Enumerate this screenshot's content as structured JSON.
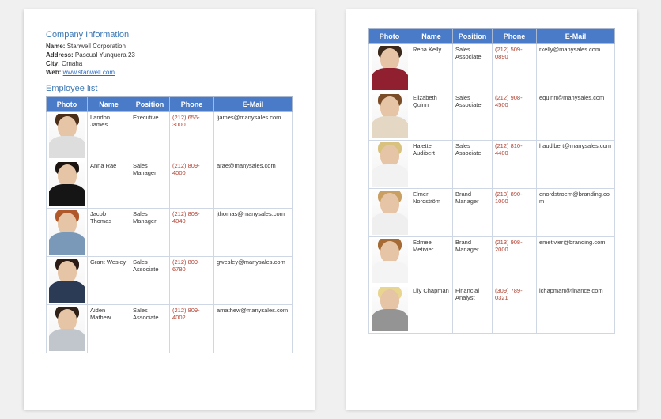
{
  "company": {
    "section_title": "Company Information",
    "name_label": "Name:",
    "name": "Stanwell Corporation",
    "address_label": "Address:",
    "address": "Pascual Yunquera 23",
    "city_label": "City:",
    "city": "Omaha",
    "web_label": "Web:",
    "web": "www.stanwell.com"
  },
  "employee_list_title": "Employee list",
  "table_headers": {
    "photo": "Photo",
    "name": "Name",
    "position": "Position",
    "phone": "Phone",
    "email": "E-Mail"
  },
  "employees_page1": [
    {
      "name": "Landon James",
      "position": "Executive",
      "phone": "(212) 656-3000",
      "email": "ljames@manysales.com",
      "hair": "#4a2e18",
      "shirt": "#dddddd"
    },
    {
      "name": "Anna Rae",
      "position": "Sales Manager",
      "phone": "(212) 809-4000",
      "email": "arae@manysales.com",
      "hair": "#1c1410",
      "shirt": "#151515"
    },
    {
      "name": "Jacob Thomas",
      "position": "Sales Manager",
      "phone": "(212) 808-4040",
      "email": "jthomas@manysales.com",
      "hair": "#b1582a",
      "shirt": "#7a99b8"
    },
    {
      "name": "Grant Wesley",
      "position": "Sales Associate",
      "phone": "(212) 809-6780",
      "email": "gwesley@manysales.com",
      "hair": "#2a1c14",
      "shirt": "#2b3a55"
    },
    {
      "name": "Aiden Mathew",
      "position": "Sales Associate",
      "phone": "(212) 809-4002",
      "email": "amathew@manysales.com",
      "hair": "#2e2016",
      "shirt": "#c0c6cc"
    }
  ],
  "employees_page2": [
    {
      "name": "Rena Kelly",
      "position": "Sales Associate",
      "phone": "(212) 509-0890",
      "email": "rkelly@manysales.com",
      "hair": "#3b2a1c",
      "shirt": "#902030"
    },
    {
      "name": "Elizabeth Quinn",
      "position": "Sales Associate",
      "phone": "(212) 908-4500",
      "email": "equinn@manysales.com",
      "hair": "#7a4d28",
      "shirt": "#e4d7c4"
    },
    {
      "name": "Halette Audibert",
      "position": "Sales Associate",
      "phone": "(212) 810-4400",
      "email": "haudibert@manysales.com",
      "hair": "#d8c27e",
      "shirt": "#f2f2f2"
    },
    {
      "name": "Elmer Nordström",
      "position": "Brand Manager",
      "phone": "(213) 890-1000",
      "email": "enordstroem@branding.com",
      "hair": "#caa062",
      "shirt": "#efefef"
    },
    {
      "name": "Edmee Metivier",
      "position": "Brand Manager",
      "phone": "(213) 908-2000",
      "email": "emetivier@branding.com",
      "hair": "#a66a34",
      "shirt": "#f4f4f4"
    },
    {
      "name": "Lily Chapman",
      "position": "Financial Analyst",
      "phone": "(309) 789-0321",
      "email": "lchapman@finance.com",
      "hair": "#e8d690",
      "shirt": "#949494"
    }
  ]
}
